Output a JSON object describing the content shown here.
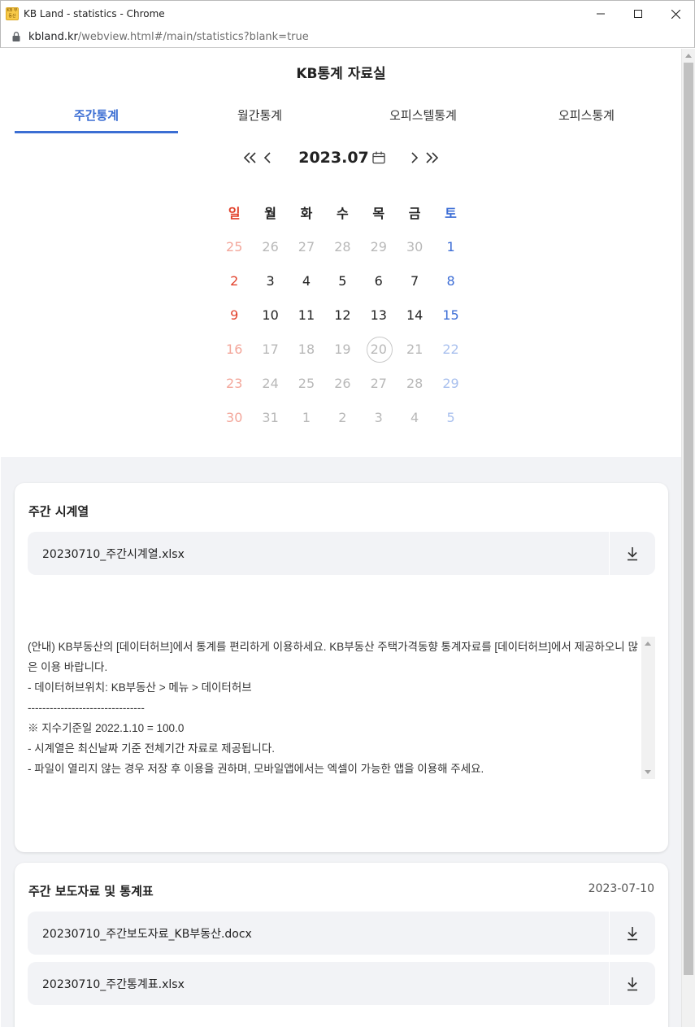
{
  "window": {
    "title": "KB Land - statistics - Chrome",
    "favicon_text": "KB 부동산"
  },
  "address": {
    "domain": "kbland.kr",
    "path": "/webview.html#/main/statistics?blank=true"
  },
  "page": {
    "title": "KB통계 자료실"
  },
  "tabs": [
    {
      "label": "주간통계",
      "active": true
    },
    {
      "label": "월간통계",
      "active": false
    },
    {
      "label": "오피스텔통계",
      "active": false
    },
    {
      "label": "오피스통계",
      "active": false
    }
  ],
  "calendar": {
    "month_label": "2023.07",
    "weekdays": [
      "일",
      "월",
      "화",
      "수",
      "목",
      "금",
      "토"
    ],
    "today": "20",
    "weeks": [
      [
        "25",
        "26",
        "27",
        "28",
        "29",
        "30",
        "1"
      ],
      [
        "2",
        "3",
        "4",
        "5",
        "6",
        "7",
        "8"
      ],
      [
        "9",
        "10",
        "11",
        "12",
        "13",
        "14",
        "15"
      ],
      [
        "16",
        "17",
        "18",
        "19",
        "20",
        "21",
        "22"
      ],
      [
        "23",
        "24",
        "25",
        "26",
        "27",
        "28",
        "29"
      ],
      [
        "30",
        "31",
        "1",
        "2",
        "3",
        "4",
        "5"
      ]
    ]
  },
  "weekly_series": {
    "title": "주간 시계열",
    "file": "20230710_주간시계열.xlsx",
    "notice_lines": [
      "(안내) KB부동산의 [데이터허브]에서 통계를 편리하게 이용하세요. KB부동산 주택가격동향 통계자료를 [데이터허브]에서 제공하오니 많은 이용 바랍니다.",
      "- 데이터허브위치: KB부동산 > 메뉴 > 데이터허브",
      "--------------------------------",
      "※  지수기준일  2022.1.10 = 100.0",
      "- 시계열은 최신날짜 기준 전체기간 자료로 제공됩니다.",
      "- 파일이 열리지 않는 경우 저장 후 이용을 권하며, 모바일앱에서는 엑셀이 가능한 앱을 이용해 주세요."
    ]
  },
  "weekly_report": {
    "title": "주간 보도자료 및 통계표",
    "date": "2023-07-10",
    "files": [
      "20230710_주간보도자료_KB부동산.docx",
      "20230710_주간통계표.xlsx"
    ]
  },
  "colors": {
    "accent": "#3b6ed3",
    "sunday": "#e2412b",
    "saturday": "#3d6ed6",
    "panel_bg": "#f2f3f6"
  }
}
